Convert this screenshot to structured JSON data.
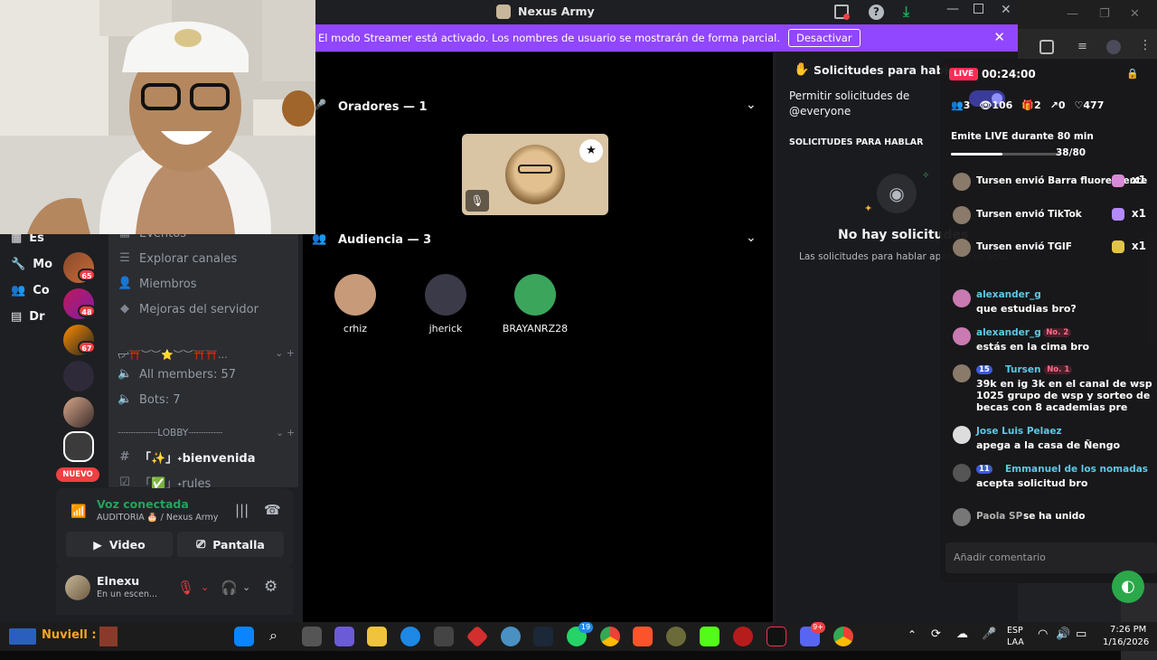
{
  "discord": {
    "window_title": "Nexus Army",
    "banner_message": "El modo Streamer está activado. Los nombres de usuario se mostrarán de forma parcial.",
    "banner_button": "Desactivar",
    "left_nav": [
      "Es",
      "Mo",
      "Co",
      "Dr"
    ],
    "server_badges": [
      "65",
      "48",
      "67"
    ],
    "new_badge": "NUEVO",
    "channels": {
      "events_label": "Eventos",
      "explore_label": "Explorar canales",
      "members_label": "Miembros",
      "boosts_label": "Mejoras del servidor",
      "category1": "ᡕᠵ᠊ᡃ⛩️︶︶⭐︶︶⛩️⛩️...",
      "all_members": "All members: 57",
      "bots": "Bots: 7",
      "lobby_category": "┈┈┈┈┈┈┈LOBBY┈┈┈┈┈┈",
      "welcome": "「✨」˖bienvenida",
      "rules": "「✅」˖rules"
    },
    "voice": {
      "status": "Voz conectada",
      "channel": "AUDITORIA 🎂 / Nexus Army",
      "video_button": "Video",
      "screen_button": "Pantalla"
    },
    "user": {
      "name": "Elnexu",
      "status": "En un escen..."
    },
    "stage": {
      "speakers_header": "Oradores — 1",
      "audience_header": "Audiencia — 3",
      "audience": [
        {
          "name": "crhiz",
          "color": "#c79a7a"
        },
        {
          "name": "jherick",
          "color": "#3a3a48"
        },
        {
          "name": "BRAYANRZ28",
          "color": "#3ba55c"
        }
      ]
    },
    "requests": {
      "title": "Solicitudes para hablar",
      "permit": "Permitir solicitudes de @everyone",
      "section": "SOLICITUDES PARA HABLAR",
      "empty_title": "No hay solicitudes",
      "empty_sub": "Las solicitudes para hablar aparecerán aquí."
    }
  },
  "tiktok": {
    "live_badge": "LIVE",
    "timer": "00:24:00",
    "stats": {
      "viewers_a": "3",
      "views": "106",
      "gifts": "2",
      "shares": "0",
      "likes": "477"
    },
    "goal_text": "Emite LIVE durante 80 min",
    "goal_progress": "38/80",
    "goal_fraction": 0.475,
    "gifts": [
      {
        "text": "Tursen envió Barra fluorescente",
        "count": "x1"
      },
      {
        "text": "Tursen envió TikTok",
        "count": "x1"
      },
      {
        "text": "Tursen envió TGIF",
        "count": "x1"
      }
    ],
    "comments": [
      {
        "name": "alexander_g",
        "text": "que estudias bro?",
        "badge": ""
      },
      {
        "name": "alexander_g",
        "text": "estás en la cima bro",
        "badge": "No. 2"
      },
      {
        "name": "Tursen",
        "text": "39k en ig 3k en el canal de wsp 1025 grupo de wsp y sorteo de becas con 8 academias pre",
        "badge": "No. 1",
        "level": "15"
      },
      {
        "name": "Jose Luis Pelaez",
        "text": "apega a la casa de Ñengo",
        "badge": ""
      },
      {
        "name": "Emmanuel de los nomadas",
        "text": "acepta solicitud bro",
        "badge": "",
        "level": "11"
      }
    ],
    "join": {
      "name": "Paola SP",
      "text": "se ha unido"
    },
    "comment_placeholder": "Añadir comentario"
  },
  "taskbar": {
    "game_label": "Nuviell :",
    "lang": "ESP",
    "lang2": "LAA",
    "time": "7:26 PM",
    "date": "1/16/2026",
    "badge_whatsapp": "19",
    "badge_discord": "9+"
  },
  "colors": {
    "accent": "#9146ff",
    "discord_green": "#23a55a",
    "tiktok_live": "#fe2c55"
  }
}
